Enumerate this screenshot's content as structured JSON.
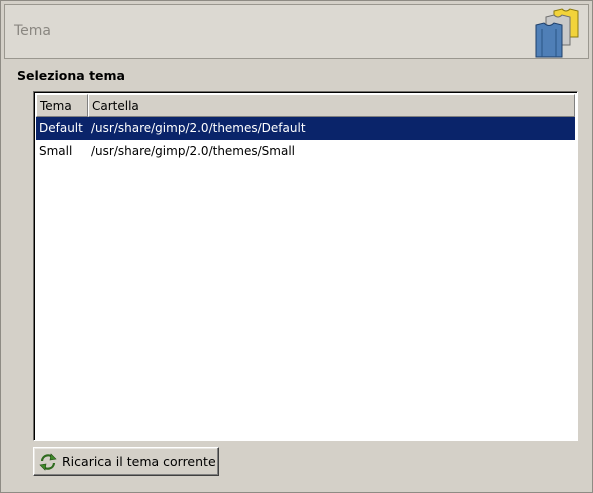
{
  "header": {
    "title": "Tema",
    "icon": "theme-shirts-icon"
  },
  "section": {
    "label": "Seleziona tema"
  },
  "table": {
    "columns": [
      "Tema",
      "Cartella"
    ],
    "rows": [
      {
        "tema": "Default",
        "cartella": "/usr/share/gimp/2.0/themes/Default",
        "selected": true
      },
      {
        "tema": "Small",
        "cartella": "/usr/share/gimp/2.0/themes/Small",
        "selected": false
      }
    ]
  },
  "reload_button": {
    "label": "Ricarica il tema corrente",
    "icon": "refresh-icon"
  },
  "colors": {
    "selection": "#0a246a",
    "background": "#d4d0c8"
  }
}
